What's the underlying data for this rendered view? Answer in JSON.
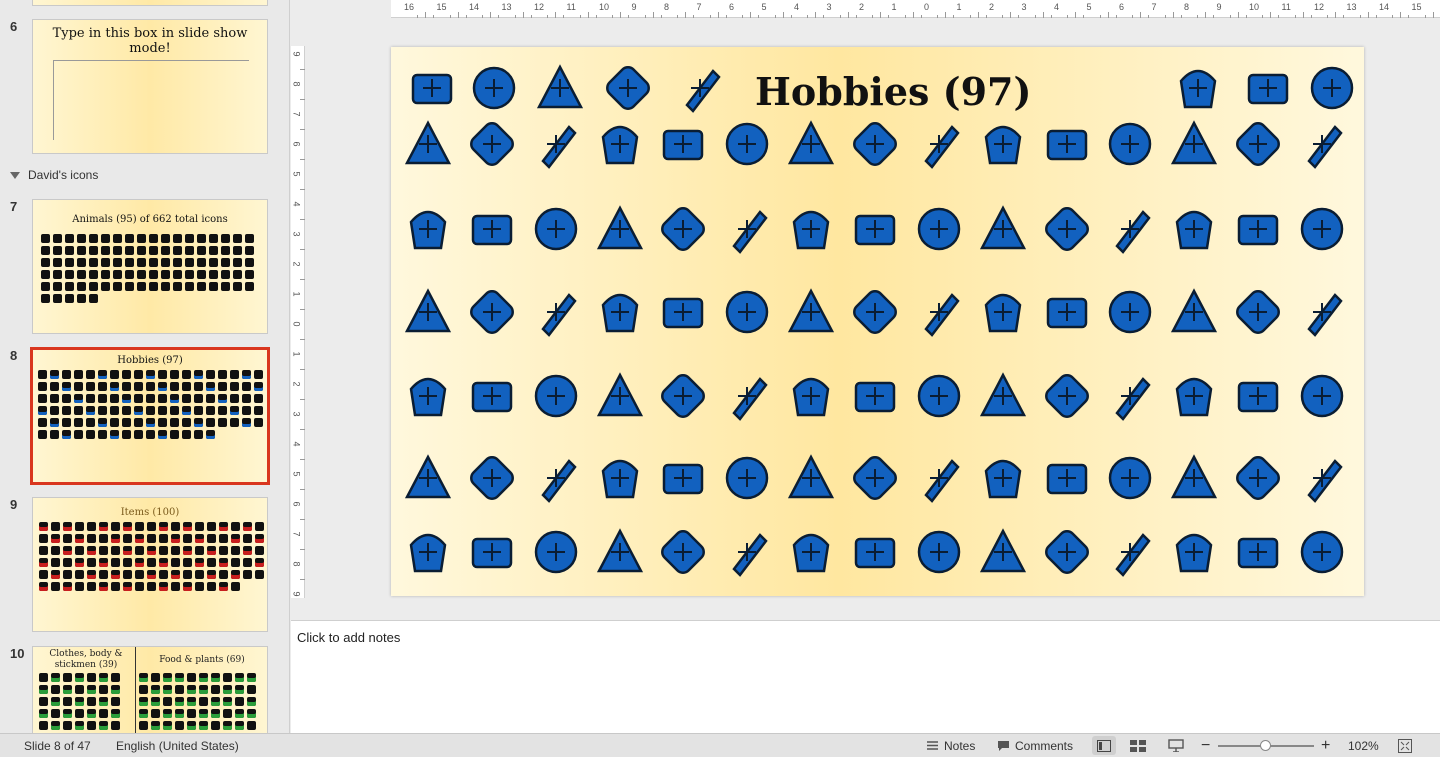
{
  "thumbnails": {
    "slide6": {
      "number": "6",
      "text": "Type in this box in slide show mode!"
    },
    "section": {
      "label": "David's icons"
    },
    "slide7": {
      "number": "7",
      "title": "Animals (95) of 662 total icons"
    },
    "slide8": {
      "number": "8",
      "title": "Hobbies (97)"
    },
    "slide9": {
      "number": "9",
      "title": "Items (100)"
    },
    "slide10": {
      "number": "10",
      "title_left": "Clothes, body & stickmen (39)",
      "title_right": "Food & plants (69)"
    }
  },
  "ruler": {
    "horizontal": [
      "16",
      "15",
      "14",
      "13",
      "12",
      "11",
      "10",
      "9",
      "8",
      "7",
      "6",
      "5",
      "4",
      "3",
      "2",
      "1",
      "0",
      "1",
      "2",
      "3",
      "4",
      "5",
      "6",
      "7",
      "8",
      "9",
      "10",
      "11",
      "12",
      "13",
      "14",
      "15",
      "16"
    ],
    "vertical": [
      "9",
      "8",
      "7",
      "6",
      "5",
      "4",
      "3",
      "2",
      "1",
      "0",
      "1",
      "2",
      "3",
      "4",
      "5",
      "6",
      "7",
      "8",
      "9"
    ]
  },
  "slide": {
    "title": "Hobbies (97)",
    "icon_color": "#1261bf",
    "icons": [
      "piano-keyboard",
      "clapperboard",
      "video-camera",
      "books",
      "presentation-board",
      "film-projector",
      "camera",
      "weightlifter",
      "skier",
      "baseball",
      "ribbon",
      "theater-masks",
      "monitor",
      "teacher",
      "desktop",
      "computer-tower",
      "laptop",
      "smartphone",
      "tablet",
      "guitar",
      "volleyball",
      "crossed-swords",
      "bow-arrow",
      "dice",
      "balloon",
      "carousel-horse",
      "pumpkin",
      "circus-tent",
      "medal",
      "shopping-cart",
      "gift",
      "palette",
      "lipstick",
      "ring",
      "christmas-tree",
      "bouquet",
      "knife",
      "playing-card",
      "crossed-tools",
      "diamond",
      "fencer",
      "magnet",
      "basketball",
      "tree-lights",
      "hockey-stick",
      "football",
      "cricket-bat",
      "jersey",
      "roller-coaster",
      "speaker",
      "shield",
      "spade",
      "club",
      "volleyball-2",
      "badminton",
      "ping-pong-paddle",
      "karate-gi",
      "gamepad",
      "medal-2",
      "soccer-ball",
      "joystick",
      "cap",
      "ping-pong",
      "rugby-ball",
      "ice-skate",
      "golf",
      "bowling",
      "billiard-ball",
      "gamepad-2",
      "music-note",
      "saxophone",
      "music-notes",
      "saxophone-2",
      "microphone",
      "trumpet",
      "electric-guitar",
      "french-horn",
      "hammer",
      "tools",
      "volume",
      "gear",
      "bell",
      "bell-outline",
      "shoe",
      "clarinet",
      "megaphone",
      "target",
      "studio-mic",
      "treble-clef",
      "trophy",
      "dj-mixer",
      "drum",
      "radio",
      "music-notes-2",
      "hammer-2",
      "wrench-hammer",
      "chemistry",
      "microscope"
    ]
  },
  "notes": {
    "placeholder": "Click to add notes"
  },
  "statusbar": {
    "slide_info": "Slide 8 of 47",
    "language": "English (United States)",
    "notes_label": "Notes",
    "comments_label": "Comments",
    "zoom": "102%",
    "zoom_level": 0.5
  }
}
